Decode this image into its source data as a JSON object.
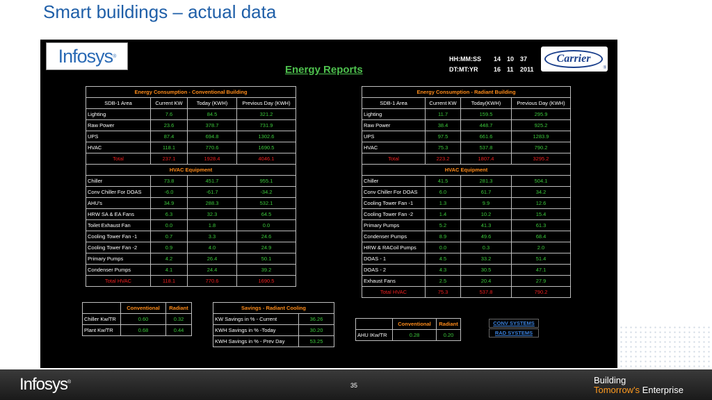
{
  "slide_title": "Smart buildings – actual data",
  "infosys_logo": "Infosys",
  "report_title": "Energy Reports",
  "clock": {
    "time_label": "HH:MM:SS",
    "time": [
      "14",
      "10",
      "37"
    ],
    "date_label": "DT:MT:YR",
    "date": [
      "16",
      "11",
      "2011"
    ]
  },
  "carrier_logo": "Carrier",
  "conventional": {
    "title": "Energy Consumption - Conventional Building",
    "headers": [
      "SDB-1 Area",
      "Current KW",
      "Today (KWH)",
      "Previous Day (KWH)"
    ],
    "rows": [
      [
        "Lighting",
        "7.6",
        "84.5",
        "321.2"
      ],
      [
        "Raw Power",
        "23.6",
        "378.7",
        "731.9"
      ],
      [
        "UPS",
        "87.4",
        "694.8",
        "1302.6"
      ],
      [
        "HVAC",
        "118.1",
        "770.6",
        "1690.5"
      ]
    ],
    "total": [
      "Total",
      "237.1",
      "1928.4",
      "4046.1"
    ],
    "hvac_title": "HVAC Equipment",
    "hvac_rows": [
      [
        "Chiller",
        "73.8",
        "451.7",
        "955.1"
      ],
      [
        "Conv Chiller For DOAS",
        "-6.0",
        "-61.7",
        "-34.2"
      ],
      [
        "AHU's",
        "34.9",
        "288.3",
        "532.1"
      ],
      [
        "HRW SA & EA Fans",
        "6.3",
        "32.3",
        "64.5"
      ],
      [
        "Toilet Exhaust Fan",
        "0.0",
        "1.8",
        "0.0"
      ],
      [
        "Cooling Tower Fan -1",
        "0.7",
        "3.3",
        "24.6"
      ],
      [
        "Cooling Tower Fan -2",
        "0.9",
        "4.0",
        "24.9"
      ],
      [
        "Primary Pumps",
        "4.2",
        "26.4",
        "50.1"
      ],
      [
        "Condenser Pumps",
        "4.1",
        "24.4",
        "39.2"
      ]
    ],
    "hvac_total": [
      "Total HVAC",
      "118.1",
      "770.6",
      "1690.5"
    ]
  },
  "radiant": {
    "title": "Energy Consumption - Radiant Building",
    "headers": [
      "SDB-1 Area",
      "Current KW",
      "Today(KWH)",
      "Previous Day (KWH)"
    ],
    "rows": [
      [
        "Lighting",
        "11.7",
        "159.5",
        "295.9"
      ],
      [
        "Raw Power",
        "38.4",
        "448.7",
        "925.2"
      ],
      [
        "UPS",
        "97.5",
        "661.6",
        "1283.9"
      ],
      [
        "HVAC",
        "75.3",
        "537.8",
        "790.2"
      ]
    ],
    "total": [
      "Total",
      "223.2",
      "1807.4",
      "3295.2"
    ],
    "hvac_title": "HVAC Equipment",
    "hvac_rows": [
      [
        "Chiller",
        "41.5",
        "281.3",
        "504.1"
      ],
      [
        "Conv Chiller For DOAS",
        "6.0",
        "61.7",
        "34.2"
      ],
      [
        "Cooling Tower Fan -1",
        "1.3",
        "9.9",
        "12.6"
      ],
      [
        "Cooling Tower Fan -2",
        "1.4",
        "10.2",
        "15.4"
      ],
      [
        "Primary Pumps",
        "5.2",
        "41.3",
        "61.3"
      ],
      [
        "Condenser Pumps",
        "8.9",
        "49.6",
        "68.4"
      ],
      [
        "HRW & RACoil Pumps",
        "0.0",
        "0.3",
        "2.0"
      ],
      [
        "DOAS - 1",
        "4.5",
        "33.2",
        "51.4"
      ],
      [
        "DOAS - 2",
        "4.3",
        "30.5",
        "47.1"
      ],
      [
        "Exhaust Fans",
        "2.5",
        "20.4",
        "27.9"
      ]
    ],
    "hvac_total": [
      "Total HVAC",
      "75.3",
      "537.8",
      "790.2"
    ]
  },
  "kw_table": {
    "headers": [
      "Conventional",
      "Radiant"
    ],
    "rows": [
      [
        "Chiller Kw/TR",
        "0.60",
        "0.32"
      ],
      [
        "Plant Kw/TR",
        "0.68",
        "0.44"
      ]
    ]
  },
  "savings": {
    "title": "Savings - Radiant Cooling",
    "rows": [
      [
        "KW Savings in % - Current",
        "36.26"
      ],
      [
        "KWH Savings in % -Today",
        "30.20"
      ],
      [
        "KWH Savings in % - Prev Day",
        "53.25"
      ]
    ]
  },
  "ahu_table": {
    "headers": [
      "Conventional",
      "Radiant"
    ],
    "row": [
      "AHU IKw/TR",
      "0.28",
      "0.20"
    ]
  },
  "links": {
    "conv": "CONV SYSTEMS",
    "rad": "RAD SYSTEMS"
  },
  "footer": {
    "logo": "Infosys",
    "page": "35",
    "tagline_1": "Building",
    "tagline_2a": "Tomorrow's",
    "tagline_2b": " Enterprise"
  }
}
